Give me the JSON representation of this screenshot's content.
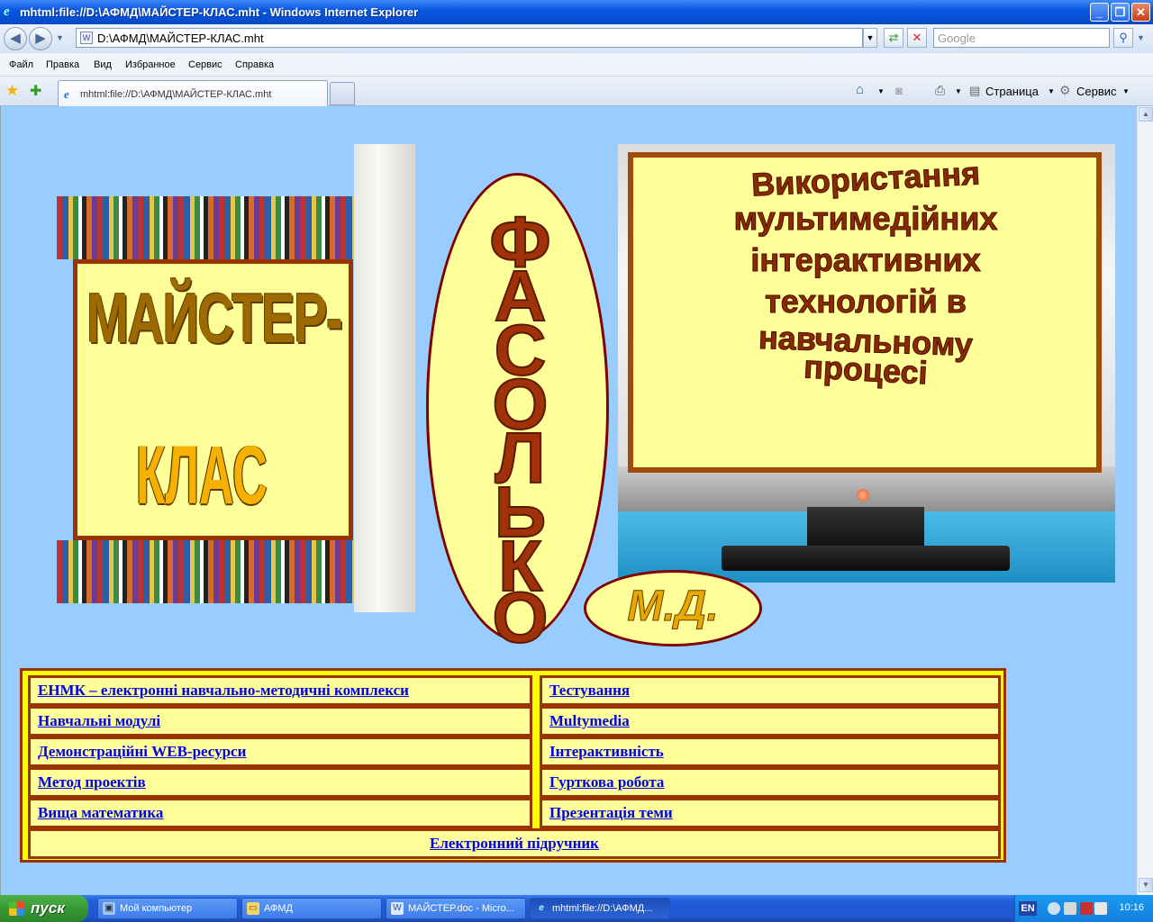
{
  "window": {
    "title": "mhtml:file://D:\\АФМД\\МАЙСТЕР-КЛАС.mht - Windows Internet Explorer"
  },
  "address": {
    "url": "D:\\АФМД\\МАЙСТЕР-КЛАС.mht",
    "search_placeholder": "Google"
  },
  "menu": [
    "Файл",
    "Правка",
    "Вид",
    "Избранное",
    "Сервис",
    "Справка"
  ],
  "tab": {
    "label": "mhtml:file://D:\\АФМД\\МАЙСТЕР-КЛАС.mht"
  },
  "commands": {
    "page": "Страница",
    "tools": "Сервис"
  },
  "page": {
    "book_title_1": "МАЙСТЕР-",
    "book_title_2": "КЛАС",
    "vertical_letters": [
      "Ф",
      "А",
      "С",
      "О",
      "Л",
      "Ь",
      "К",
      "О"
    ],
    "screen_lines": [
      "Використання",
      "мультимедійних",
      "інтерактивних",
      "технологій в",
      "навчальному",
      "процесі"
    ],
    "initials": "М.Д.",
    "links_left": [
      "ЕНМК – електронні навчально-методичні комплекси",
      "Навчальні модулі",
      "Демонстраційні WEB-ресурси",
      "Метод проектів",
      "Вища математика"
    ],
    "links_right": [
      "Тестування",
      "Multymedia",
      "Інтерактивність",
      "Гурткова робота",
      "Презентація теми"
    ],
    "link_full": "Електронний підручник"
  },
  "taskbar": {
    "start": "пуск",
    "tasks": [
      "Мой компьютер",
      "АФМД",
      "МАЙСТЕР.doc - Micro...",
      "mhtml:file://D:\\АФМД..."
    ],
    "lang": "EN",
    "clock": "10:16"
  },
  "colors": {
    "page_bg": "#99ccff",
    "panel_yellow": "#ffff99",
    "border_brown": "#993300",
    "link_blue": "#0000ee"
  }
}
